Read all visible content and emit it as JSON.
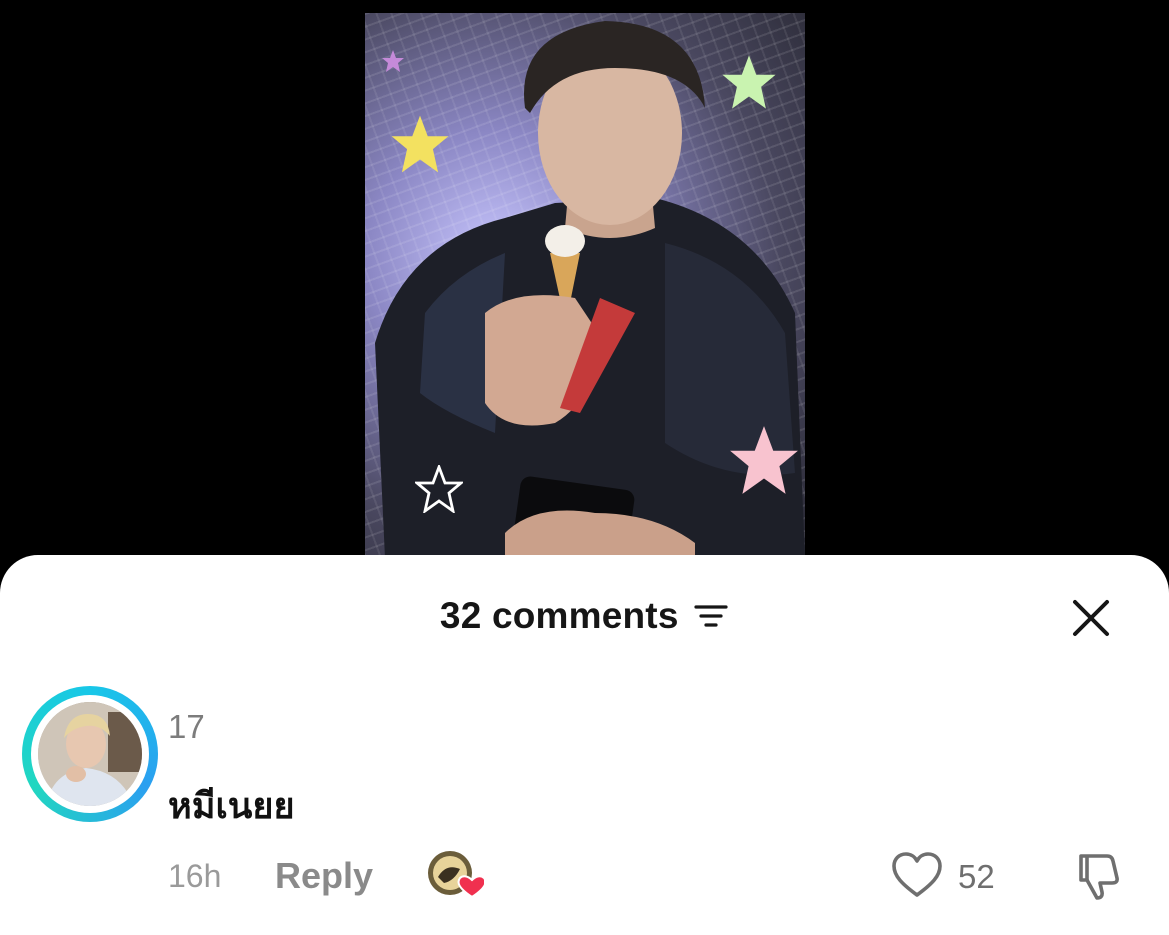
{
  "sheet": {
    "comment_count_label": "32 comments"
  },
  "comment": {
    "username": "17",
    "text": "หมีเนยย",
    "time": "16h",
    "reply_label": "Reply",
    "like_count": "52"
  },
  "icons": {
    "filter": "filter-icon",
    "close": "close-icon",
    "like": "heart-outline-icon",
    "dislike": "thumbs-down-icon",
    "creator_liked": "creator-liked-heart-icon"
  },
  "colors": {
    "avatar_ring": "#18c7e8",
    "liked_heart": "#f0304f"
  }
}
